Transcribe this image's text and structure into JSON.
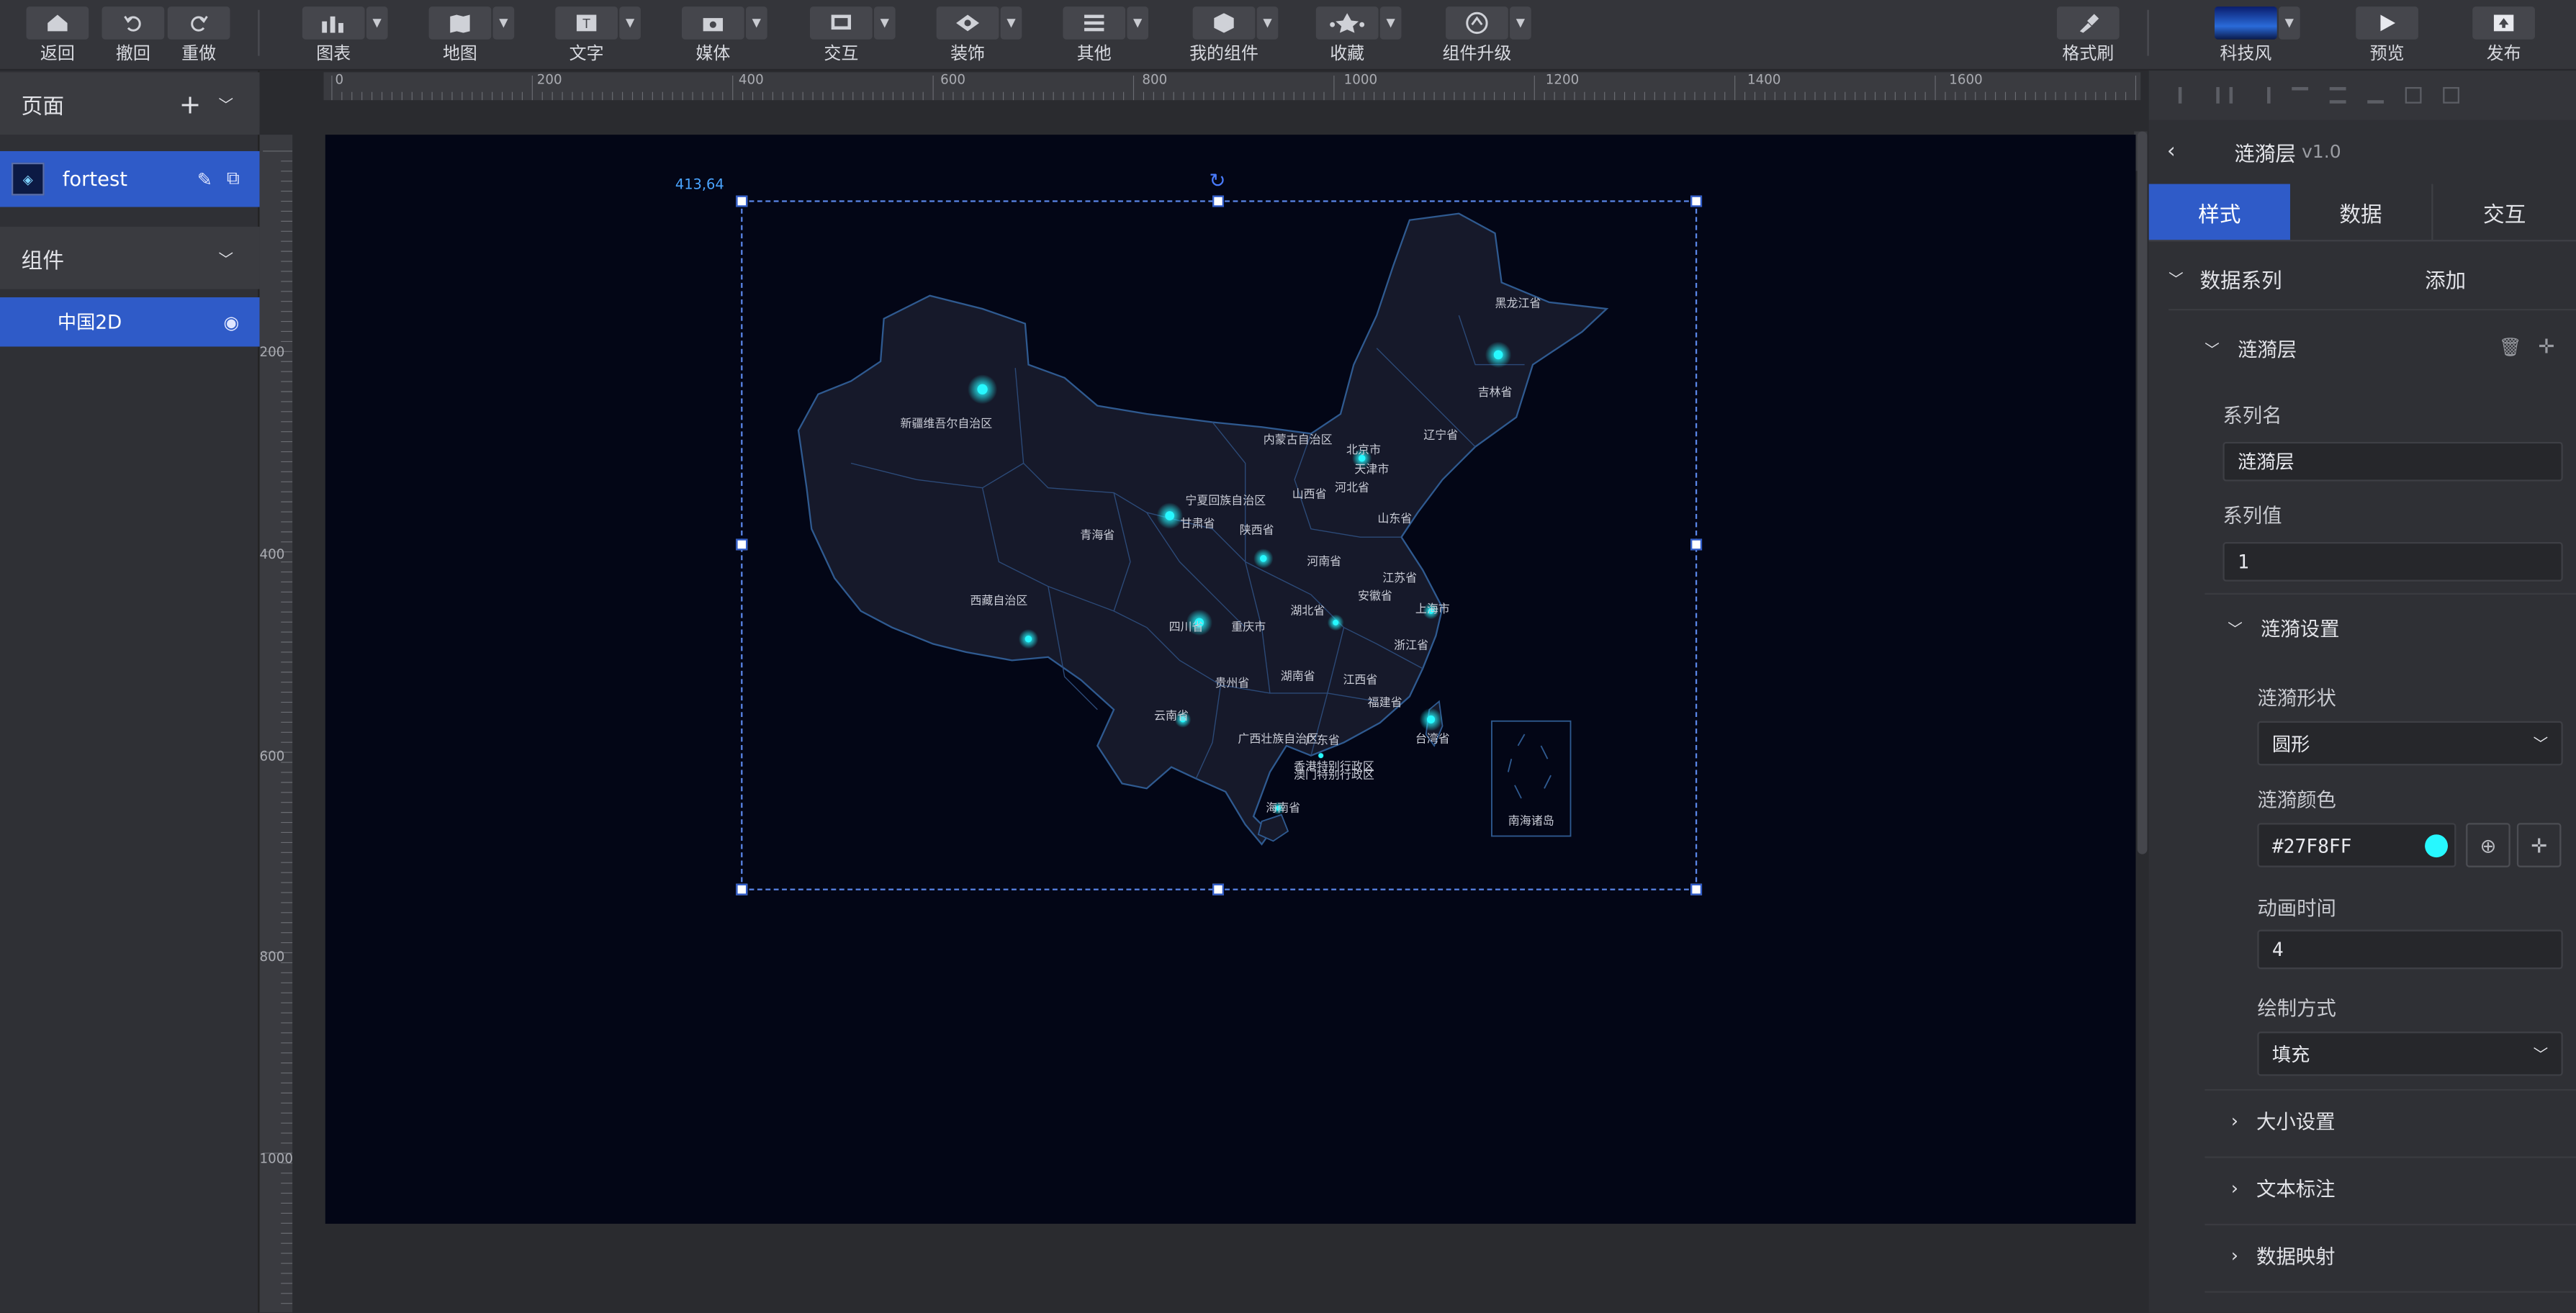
{
  "toolbar": {
    "back": "返回",
    "undo": "撤回",
    "redo": "重做",
    "chart": "图表",
    "map": "地图",
    "text": "文字",
    "media": "媒体",
    "interact": "交互",
    "decor": "装饰",
    "other": "其他",
    "mycomp": "我的组件",
    "favorite": "收藏",
    "upgrade": "组件升级",
    "formatbrush": "格式刷",
    "theme": "科技风",
    "preview": "预览",
    "publish": "发布"
  },
  "left": {
    "pages_title": "页面",
    "page_name": "fortest",
    "components_title": "组件",
    "component_name": "中国2D"
  },
  "ruler": {
    "h": [
      "0",
      "200",
      "400",
      "600",
      "800",
      "1000",
      "1200",
      "1400",
      "1600"
    ],
    "v": [
      "200",
      "400",
      "600",
      "800",
      "1000"
    ]
  },
  "canvas": {
    "coord": "413,64",
    "map_labels": [
      "黑龙江省",
      "吉林省",
      "辽宁省",
      "内蒙古自治区",
      "北京市",
      "天津市",
      "河北省",
      "山西省",
      "山东省",
      "新疆维吾尔自治区",
      "宁夏回族自治区",
      "甘肃省",
      "陕西省",
      "青海省",
      "河南省",
      "江苏省",
      "安徽省",
      "上海市",
      "西藏自治区",
      "四川省",
      "重庆市",
      "湖北省",
      "浙江省",
      "贵州省",
      "湖南省",
      "江西省",
      "福建省",
      "云南省",
      "广西壮族自治区",
      "广东省",
      "台湾省",
      "香港特别行政区",
      "澳门特别行政区",
      "海南省",
      "南海诸岛"
    ]
  },
  "right": {
    "title": "涟漪层",
    "version": "v1.0",
    "tabs": [
      "样式",
      "数据",
      "交互"
    ],
    "data_series": "数据系列",
    "add": "添加",
    "series_header": "涟漪层",
    "series_name_label": "系列名",
    "series_name_value": "涟漪层",
    "series_value_label": "系列值",
    "series_value": "1",
    "ripple_settings": "涟漪设置",
    "shape_label": "涟漪形状",
    "shape_value": "圆形",
    "color_label": "涟漪颜色",
    "color_value": "#27F8FF",
    "anim_label": "动画时间",
    "anim_value": "4",
    "draw_label": "绘制方式",
    "draw_value": "填充",
    "size_settings": "大小设置",
    "text_label": "文本标注",
    "data_mapping": "数据映射"
  },
  "colors": {
    "accent": "#2f5bc8",
    "ripple": "#27F8FF",
    "artboard": "#030616"
  }
}
